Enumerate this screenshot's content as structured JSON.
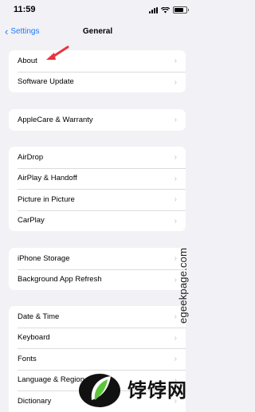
{
  "status_bar": {
    "time": "11:59"
  },
  "nav": {
    "back_label": "Settings",
    "title": "General"
  },
  "groups": [
    {
      "items": [
        {
          "label": "About"
        },
        {
          "label": "Software Update"
        }
      ]
    },
    {
      "items": [
        {
          "label": "AppleCare & Warranty"
        }
      ]
    },
    {
      "items": [
        {
          "label": "AirDrop"
        },
        {
          "label": "AirPlay & Handoff"
        },
        {
          "label": "Picture in Picture"
        },
        {
          "label": "CarPlay"
        }
      ]
    },
    {
      "items": [
        {
          "label": "iPhone Storage"
        },
        {
          "label": "Background App Refresh"
        }
      ]
    },
    {
      "items": [
        {
          "label": "Date & Time"
        },
        {
          "label": "Keyboard"
        },
        {
          "label": "Fonts"
        },
        {
          "label": "Language & Region"
        },
        {
          "label": "Dictionary"
        }
      ]
    }
  ],
  "overlay": {
    "watermark": "egeekpage.com",
    "logo_text": "饽饽网"
  },
  "colors": {
    "accent": "#1a7cff",
    "background": "#f2f1f6",
    "annotation_arrow": "#e8343f"
  }
}
